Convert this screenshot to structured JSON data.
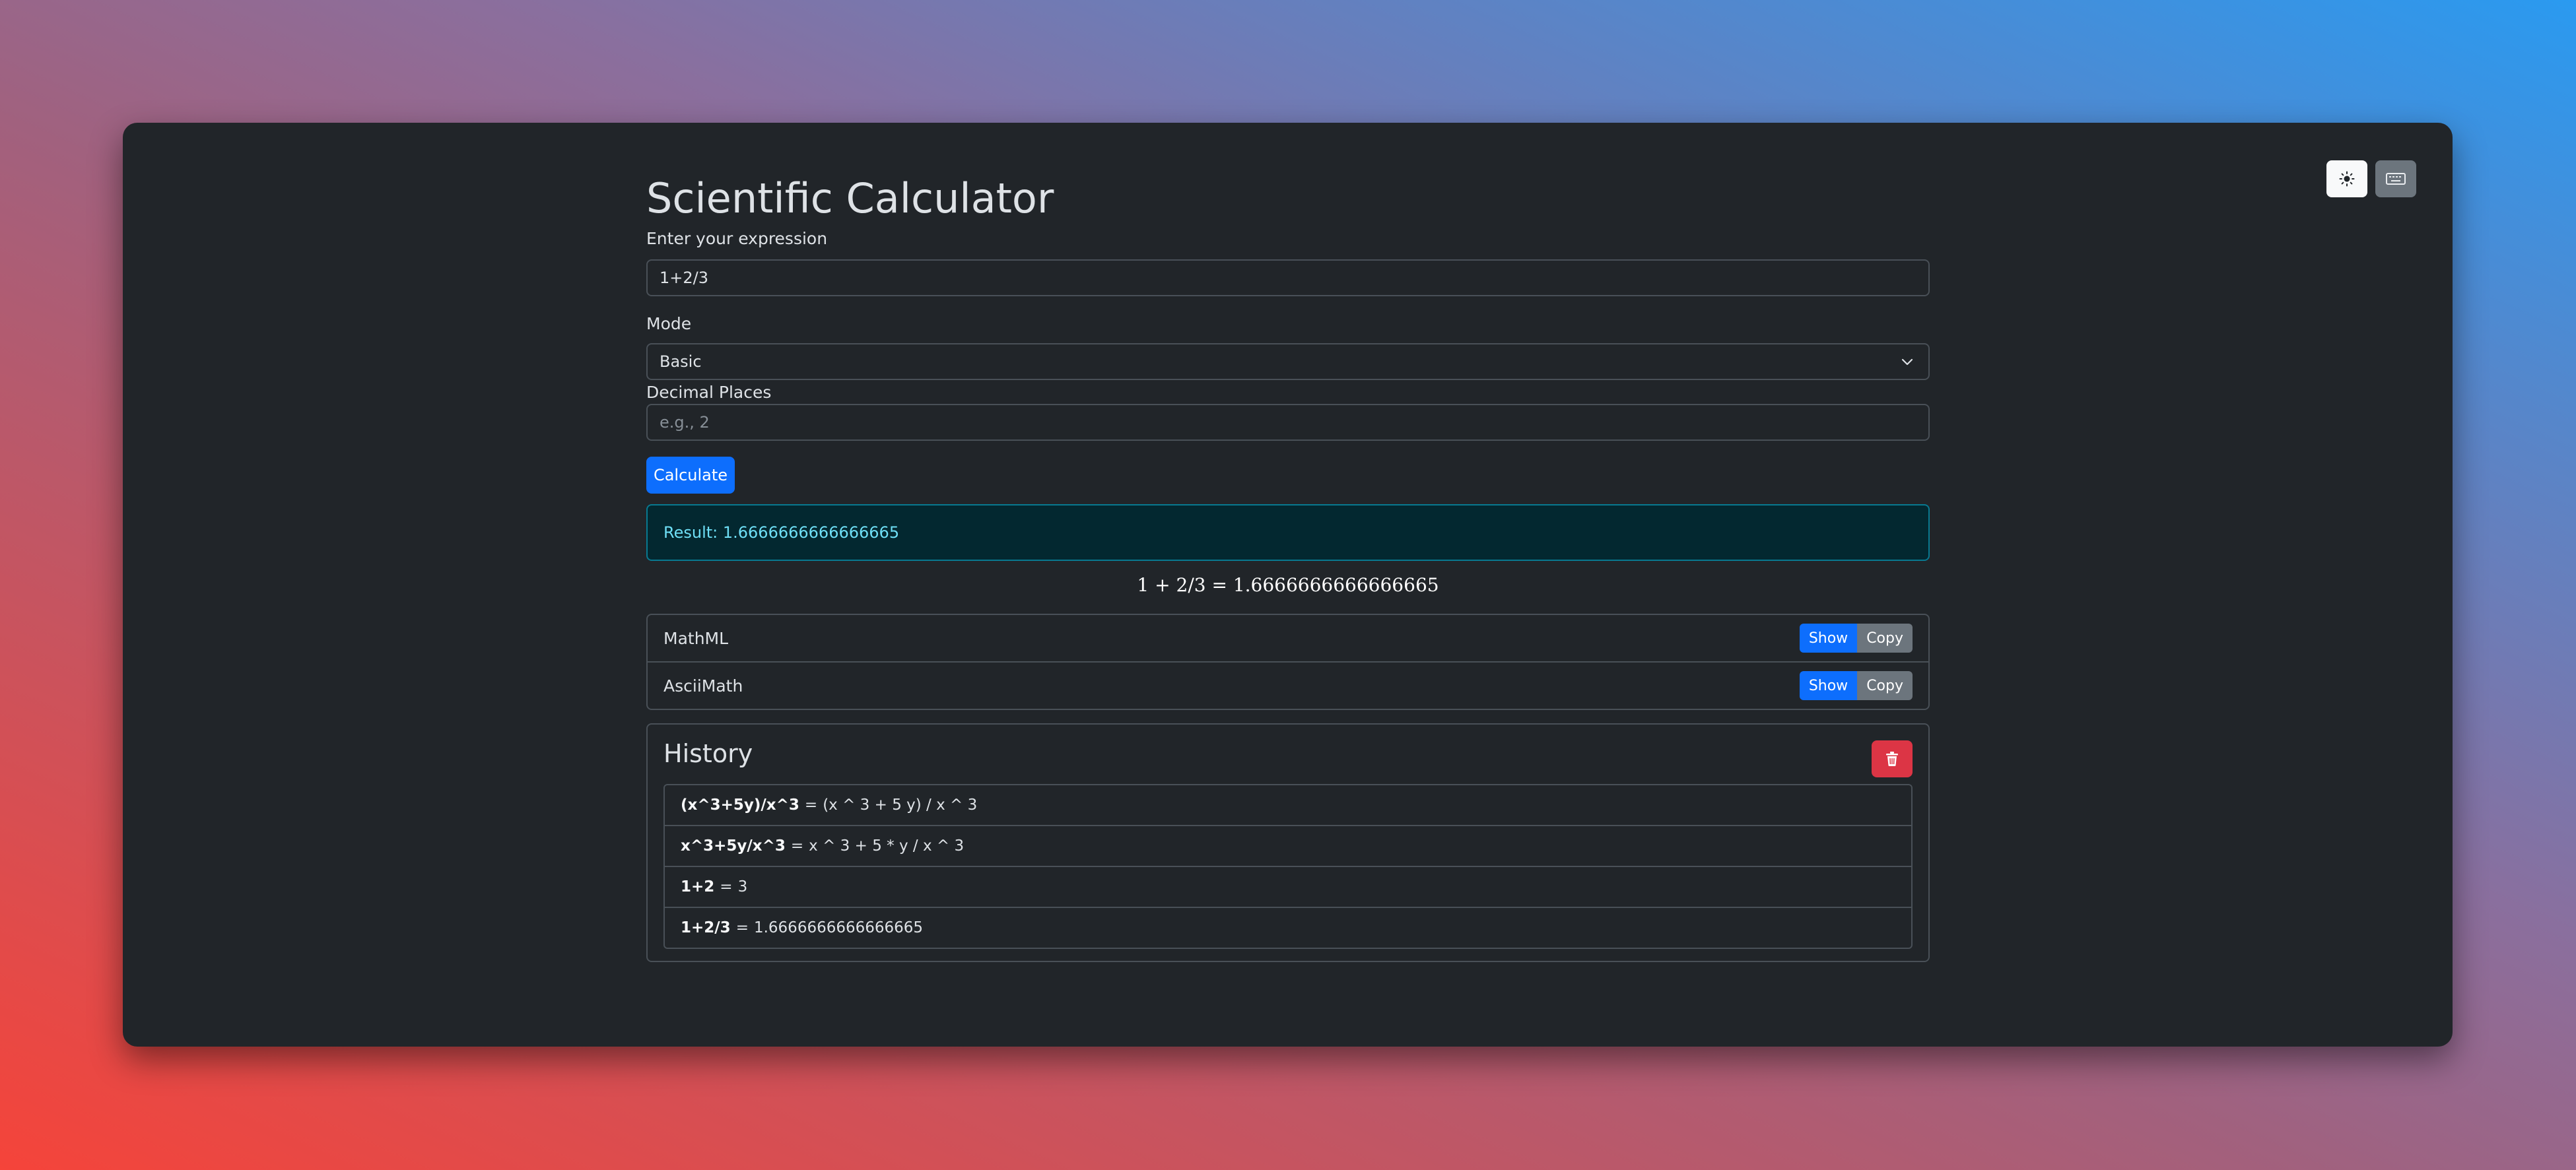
{
  "app": {
    "title": "Scientific Calculator"
  },
  "toolbar": {
    "theme_icon": "sun-icon",
    "keyboard_icon": "keyboard-icon"
  },
  "form": {
    "expression_label": "Enter your expression",
    "expression_value": "1+2/3",
    "mode_label": "Mode",
    "mode_value": "Basic",
    "decimal_label": "Decimal Places",
    "decimal_placeholder": "e.g., 2",
    "calculate_label": "Calculate"
  },
  "result": {
    "text": "Result: 1.6666666666666665",
    "formula": "1 + 2/3 = 1.6666666666666665"
  },
  "formats": [
    {
      "name": "MathML",
      "show_label": "Show",
      "copy_label": "Copy"
    },
    {
      "name": "AsciiMath",
      "show_label": "Show",
      "copy_label": "Copy"
    }
  ],
  "history": {
    "title": "History",
    "clear_icon": "trash-icon",
    "items": [
      {
        "input": "(x^3+5y)/x^3",
        "eq": "=",
        "output": "(x ^ 3 + 5 y) / x ^ 3"
      },
      {
        "input": "x^3+5y/x^3",
        "eq": "=",
        "output": "x ^ 3 + 5 * y / x ^ 3"
      },
      {
        "input": "1+2",
        "eq": "=",
        "output": "3"
      },
      {
        "input": "1+2/3",
        "eq": "=",
        "output": "1.6666666666666665"
      }
    ]
  },
  "colors": {
    "primary": "#0d6efd",
    "secondary": "#6c757d",
    "danger": "#dc3545",
    "info_text": "#6edff6",
    "surface": "#212529"
  }
}
